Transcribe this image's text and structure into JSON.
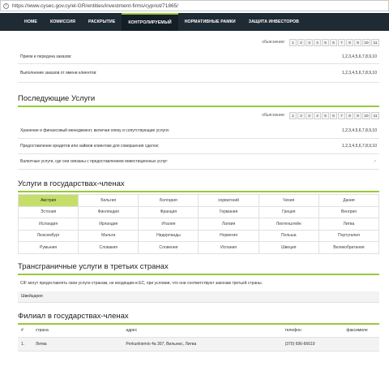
{
  "browser": {
    "url": "https://www.cysec.gov.cy/el-GR/entities/investment-firms/cypriot/71865/"
  },
  "nav": {
    "items": [
      {
        "label": "HOME",
        "active": false
      },
      {
        "label": "КОМИССИЯ",
        "active": false
      },
      {
        "label": "РАСКРЫТИЕ",
        "active": false
      },
      {
        "label": "КОНТРОЛИРУЕМЫЙ",
        "active": true
      },
      {
        "label": "НОРМАТИВНЫЕ РАМКИ",
        "active": false
      },
      {
        "label": "ЗАЩИТА ИНВЕСТОРОВ",
        "active": false
      }
    ]
  },
  "pager_label": "обьяснение:",
  "pager_pages": [
    "1",
    "2",
    "3",
    "4",
    "5",
    "6",
    "7",
    "8",
    "9",
    "10",
    "11"
  ],
  "investment_services": [
    {
      "name": "Прием и передача заказов:",
      "value": "1,2,3,4,5,6,7,8,9,10"
    },
    {
      "name": "Выполнение заказов от имени клиентов:",
      "value": "1,2,3,4,5,6,7,8,9,10"
    }
  ],
  "ancillary": {
    "title": "Последующие Услуги",
    "rows": [
      {
        "name": "Хранение и финансовый менеджмент, включая опеку и сопутствующие услуги:",
        "value": "1,2,3,4,5,6,7,8,9,10"
      },
      {
        "name": "Предоставление кредитов или займов клиентам для совершения сделок:",
        "value": "1,2,3,4,5,6,7,8,9,10"
      },
      {
        "name": "Валютные услуги, где они связаны с предоставлением инвестиционных услуг:",
        "value": "✓"
      }
    ]
  },
  "member_states": {
    "title": "Услуги в государствах-членах",
    "countries": [
      "Австрия",
      "Бельгия",
      "Болгария",
      "хорватский",
      "Чехия",
      "Дания",
      "Эстония",
      "Финляндия",
      "Франция",
      "Германия",
      "Греция",
      "Венгрия",
      "Исландия",
      "Ирландия",
      "Италия",
      "Латвия",
      "Лихтенштейн",
      "Литва",
      "Люксембург",
      "Мальта",
      "Нидерланды",
      "Норвегия",
      "Польша",
      "Португалия",
      "Румыния",
      "Словакия",
      "Словения",
      "Испания",
      "Швеция",
      "Великобритания"
    ],
    "highlighted": "Австрия"
  },
  "third_countries": {
    "title": "Трансграничные услуги в третьих странах",
    "note": "CIF могут предоставлять свои услуги странам, не входящим в ЕС, при условии, что они соответствуют законам третьей страны.",
    "countries": [
      "Швейцария"
    ]
  },
  "branches": {
    "title": "Филиал в государствах-членах",
    "headers": {
      "num": "#",
      "country": "страна",
      "address": "адрес",
      "phone": "телефон",
      "fax": "факсимиле"
    },
    "rows": [
      {
        "num": "1.",
        "country": "Литва",
        "address": "Perkunkiemio 4a 307, Вильнюс, Литва",
        "phone": "(370) 696-66619",
        "fax": ""
      }
    ]
  }
}
